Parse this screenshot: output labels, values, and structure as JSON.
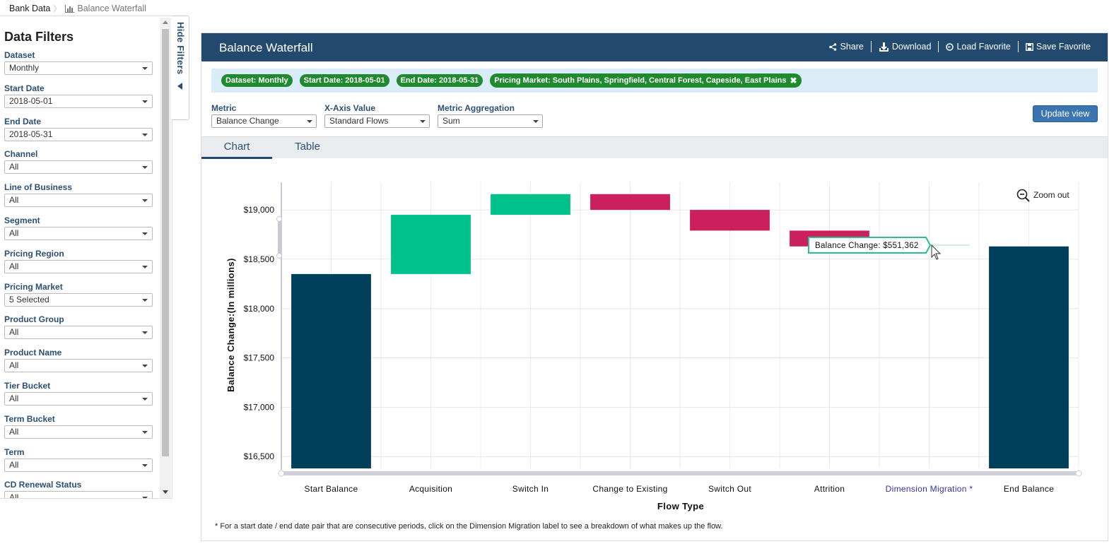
{
  "breadcrumb": {
    "root": "Bank Data",
    "current": "Balance Waterfall",
    "current_icon": "bar-chart-icon"
  },
  "sidebar": {
    "title": "Data Filters",
    "filters": [
      {
        "label": "Dataset",
        "value": "Monthly"
      },
      {
        "label": "Start Date",
        "value": "2018-05-01"
      },
      {
        "label": "End Date",
        "value": "2018-05-31"
      },
      {
        "label": "Channel",
        "value": "All"
      },
      {
        "label": "Line of Business",
        "value": "All"
      },
      {
        "label": "Segment",
        "value": "All"
      },
      {
        "label": "Pricing Region",
        "value": "All"
      },
      {
        "label": "Pricing Market",
        "value": "5 Selected"
      },
      {
        "label": "Product Group",
        "value": "All"
      },
      {
        "label": "Product Name",
        "value": "All"
      },
      {
        "label": "Tier Bucket",
        "value": "All"
      },
      {
        "label": "Term Bucket",
        "value": "All"
      },
      {
        "label": "Term",
        "value": "All"
      },
      {
        "label": "CD Renewal Status",
        "value": "All"
      }
    ],
    "hide_label": "Hide Filters"
  },
  "header": {
    "title": "Balance Waterfall",
    "actions": [
      {
        "label": "Share",
        "icon": "share-icon"
      },
      {
        "label": "Download",
        "icon": "download-icon"
      },
      {
        "label": "Load Favorite",
        "icon": "load-icon"
      },
      {
        "label": "Save Favorite",
        "icon": "save-icon"
      }
    ]
  },
  "active_filters": [
    "Dataset: Monthly",
    "Start Date: 2018-05-01",
    "End Date: 2018-05-31",
    "Pricing Market: South Plains, Springfield, Central Forest, Capeside, East Plains"
  ],
  "controls": [
    {
      "label": "Metric",
      "value": "Balance Change"
    },
    {
      "label": "X-Axis Value",
      "value": "Standard Flows"
    },
    {
      "label": "Metric Aggregation",
      "value": "Sum"
    }
  ],
  "update_button": "Update view",
  "tabs": [
    {
      "label": "Chart",
      "active": true
    },
    {
      "label": "Table",
      "active": false
    }
  ],
  "zoom_out_label": "Zoom out",
  "tooltip": "Balance Change: $551,362",
  "footnote": "* For a start date / end date pair that are consecutive periods, click on the Dimension Migration label to see a breakdown of what makes up the flow.",
  "colors": {
    "header": "#22496e",
    "pill": "#1f8a2e",
    "increase": "#00c08b",
    "decrease": "#cc1f5e",
    "total": "#003f5c",
    "link_label": "#3333aa"
  },
  "chart_data": {
    "type": "bar",
    "subtype": "waterfall",
    "xlabel": "Flow Type",
    "ylabel": "Balance Change:(In millions)",
    "ylim": [
      16380,
      19280
    ],
    "yticks": [
      "$16,500",
      "$17,000",
      "$17,500",
      "$18,000",
      "$18,500",
      "$19,000"
    ],
    "ytick_values": [
      16500,
      17000,
      17500,
      18000,
      18500,
      19000
    ],
    "categories": [
      "Start Balance",
      "Acquisition",
      "Switch In",
      "Change to Existing",
      "Switch Out",
      "Attrition",
      "Dimension Migration *",
      "End Balance"
    ],
    "bars": [
      {
        "kind": "total",
        "low": 16380,
        "high": 18350
      },
      {
        "kind": "increase",
        "low": 18350,
        "high": 18950
      },
      {
        "kind": "increase",
        "low": 18950,
        "high": 19160
      },
      {
        "kind": "decrease",
        "low": 19000,
        "high": 19160
      },
      {
        "kind": "decrease",
        "low": 18790,
        "high": 19000
      },
      {
        "kind": "decrease",
        "low": 18630,
        "high": 18790
      },
      {
        "kind": "none",
        "low": 18630,
        "high": 18630
      },
      {
        "kind": "total",
        "low": 16380,
        "high": 18630
      }
    ],
    "grid": true
  }
}
